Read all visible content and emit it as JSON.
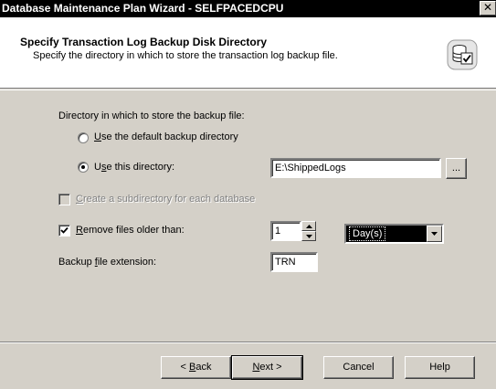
{
  "window": {
    "title": "Database Maintenance Plan Wizard - SELFPACEDCPU",
    "close_glyph": "✕"
  },
  "header": {
    "title": "Specify Transaction Log Backup Disk Directory",
    "subtitle": "Specify the directory in which to store the transaction log backup file.",
    "icon": "database-check-icon"
  },
  "form": {
    "directory_label": "Directory in which to store the backup file:",
    "default_dir_radio": {
      "prefix": "",
      "accel": "U",
      "rest": "se the default backup directory",
      "checked": false
    },
    "this_dir_radio": {
      "prefix": "U",
      "accel": "s",
      "rest": "e this directory:",
      "checked": true
    },
    "directory_value": "E:\\ShippedLogs",
    "browse_label": "...",
    "subdirectory": {
      "accel": "C",
      "rest": "reate a subdirectory for each database",
      "checked": false,
      "enabled": false
    },
    "remove_files": {
      "accel": "R",
      "rest": "emove files older than:",
      "checked": true
    },
    "age_value": "1",
    "age_unit": "Day(s)",
    "extension": {
      "prefix": "Backup ",
      "accel": "f",
      "rest": "ile extension:"
    },
    "extension_value": "TRN"
  },
  "buttons": {
    "back": {
      "prefix": "< ",
      "accel": "B",
      "rest": "ack"
    },
    "next": {
      "prefix": "",
      "accel": "N",
      "rest": "ext >"
    },
    "cancel": "Cancel",
    "help": "Help"
  }
}
